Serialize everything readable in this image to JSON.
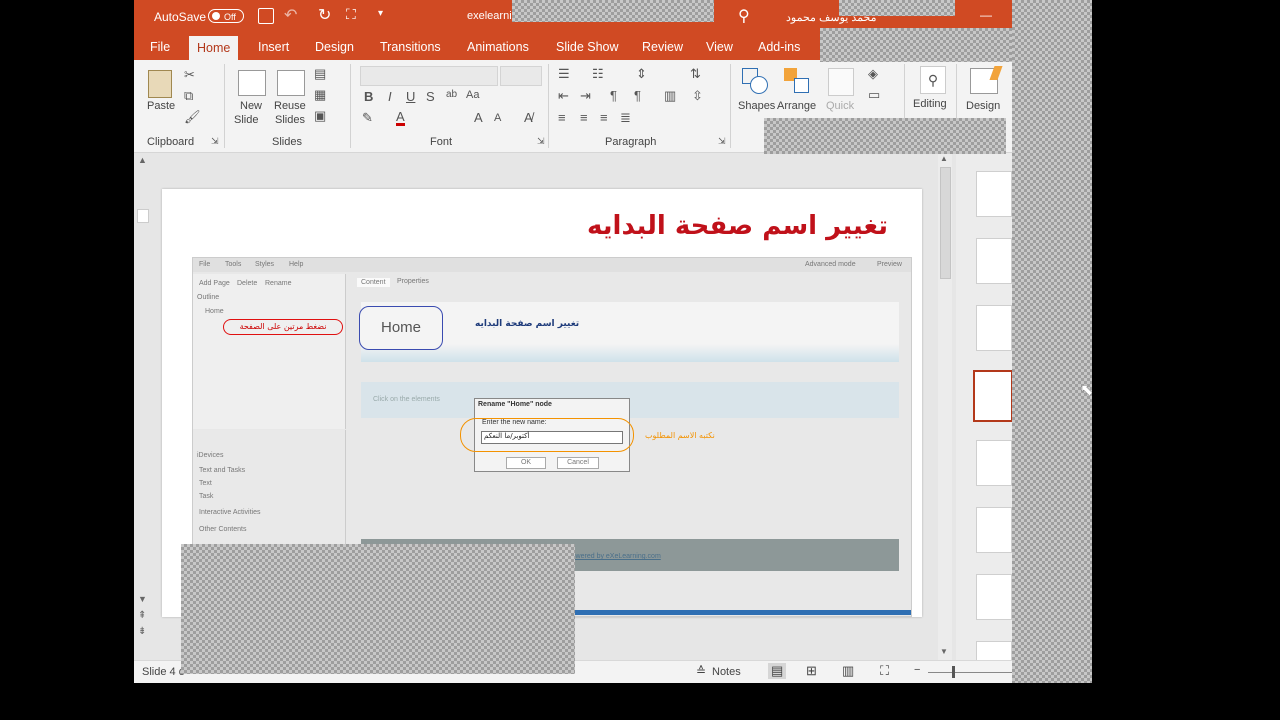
{
  "titlebar": {
    "autosave_label": "AutoSave",
    "autosave_state": "Off",
    "filename": "exelearni",
    "user_name": "محمد يوسف محمود",
    "minimize_glyph": "—"
  },
  "menu": {
    "tabs": [
      "File",
      "Home",
      "Insert",
      "Design",
      "Transitions",
      "Animations",
      "Slide Show",
      "Review",
      "View",
      "Add-ins"
    ],
    "active_index": 1
  },
  "ribbon": {
    "clipboard": {
      "paste": "Paste",
      "group": "Clipboard"
    },
    "slides": {
      "new_slide_line1": "New",
      "new_slide_line2": "Slide",
      "reuse_line1": "Reuse",
      "reuse_line2": "Slides",
      "group": "Slides"
    },
    "font": {
      "group": "Font",
      "bold": "B",
      "italic": "I",
      "underline": "U",
      "strike": "S"
    },
    "paragraph": {
      "group": "Paragraph"
    },
    "drawing": {
      "shapes": "Shapes",
      "arrange": "Arrange",
      "quick": "Quick"
    },
    "editing": {
      "label": "Editing"
    },
    "design": {
      "label_line1": "Design"
    }
  },
  "slide": {
    "title": "تغيير اسم صفحة البدايه",
    "screenshot": {
      "menu_file": "File",
      "menu_tools": "Tools",
      "menu_styles": "Styles",
      "menu_help": "Help",
      "advanced_mode": "Advanced mode",
      "preview": "Preview",
      "add_page": "Add Page",
      "delete": "Delete",
      "rename": "Rename",
      "outline": "Outline",
      "home_node": "Home",
      "double_click_note": "نضغط مرتين على الصفحة",
      "tab_content": "Content",
      "tab_properties": "Properties",
      "home_bubble": "Home",
      "page_heading": "تغيير اسم صفحة البدايه",
      "click_hint": "Click on the elements",
      "idevices": "iDevices",
      "text_tasks": "Text and Tasks",
      "text": "Text",
      "task": "Task",
      "interactive": "Interactive Activities",
      "other": "Other Contents",
      "dialog_title": "Rename \"Home\" node",
      "dialog_label": "Enter the new name:",
      "dialog_value": "أكتوبر/ما النعكم",
      "ok": "OK",
      "cancel": "Cancel",
      "write_name_note": "نكتبه الاسم المطلوب",
      "footer_link": "Powered by eXeLearning.com"
    }
  },
  "status": {
    "slide_info": "Slide 4 o",
    "notes": "Notes",
    "zoom_minus": "−"
  },
  "colors": {
    "accent": "#d04a23",
    "title_red": "#c0111a",
    "orange_note": "#f39200"
  }
}
